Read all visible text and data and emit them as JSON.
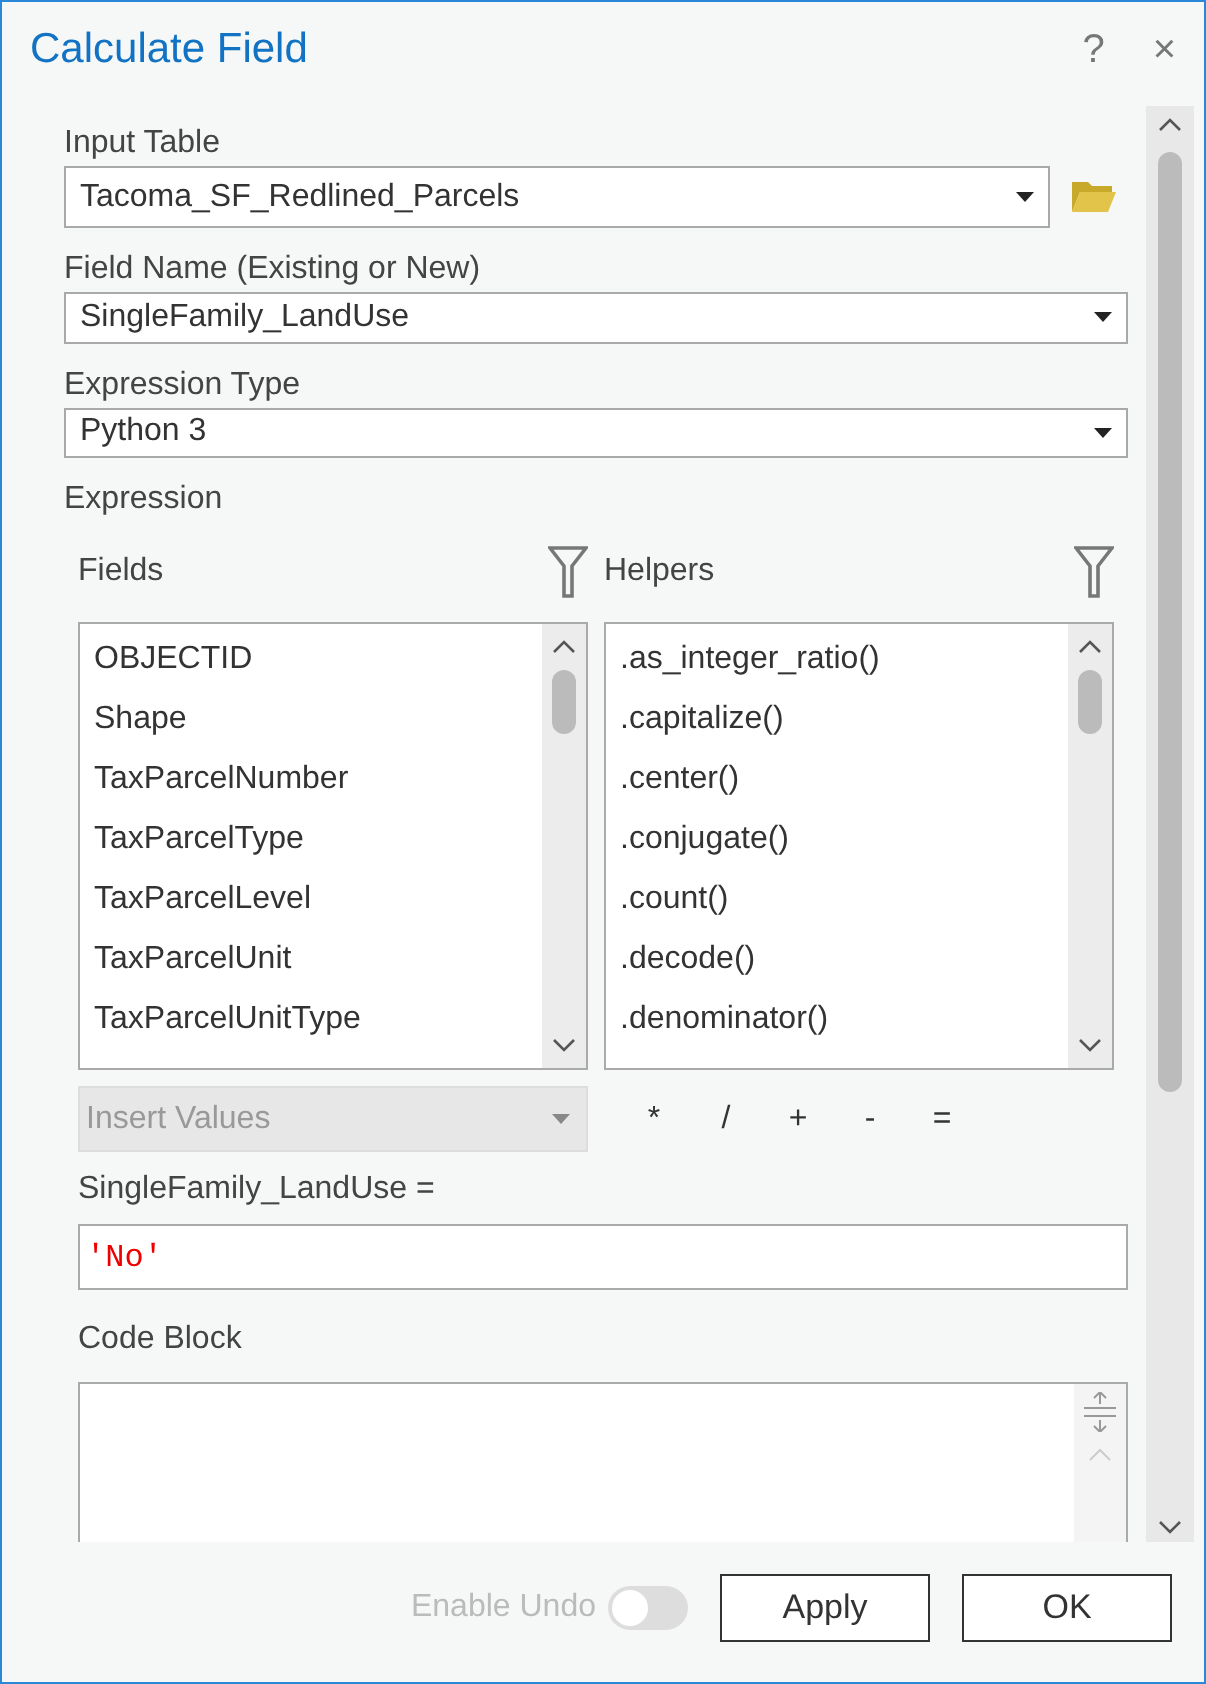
{
  "window": {
    "title": "Calculate Field",
    "help": "?",
    "close": "×"
  },
  "input_table": {
    "label": "Input Table",
    "value": "Tacoma_SF_Redlined_Parcels"
  },
  "field_name": {
    "label": "Field Name (Existing or New)",
    "value": "SingleFamily_LandUse"
  },
  "expression_type": {
    "label": "Expression Type",
    "value": "Python 3"
  },
  "expression": {
    "label": "Expression",
    "fields": {
      "label": "Fields",
      "items": [
        "OBJECTID",
        "Shape",
        "TaxParcelNumber",
        "TaxParcelType",
        "TaxParcelLevel",
        "TaxParcelUnit",
        "TaxParcelUnitType"
      ]
    },
    "helpers": {
      "label": "Helpers",
      "items": [
        ".as_integer_ratio()",
        ".capitalize()",
        ".center()",
        ".conjugate()",
        ".count()",
        ".decode()",
        ".denominator()"
      ]
    },
    "insert_values": {
      "placeholder": "Insert Values",
      "disabled": true
    },
    "operators": [
      "*",
      "/",
      "+",
      "-",
      "="
    ],
    "target_label": "SingleFamily_LandUse =",
    "value": "'No'"
  },
  "code_block": {
    "label": "Code Block"
  },
  "footer": {
    "enable_undo": {
      "label": "Enable Undo",
      "on": false,
      "disabled": true
    },
    "buttons": [
      "Apply",
      "OK"
    ]
  }
}
